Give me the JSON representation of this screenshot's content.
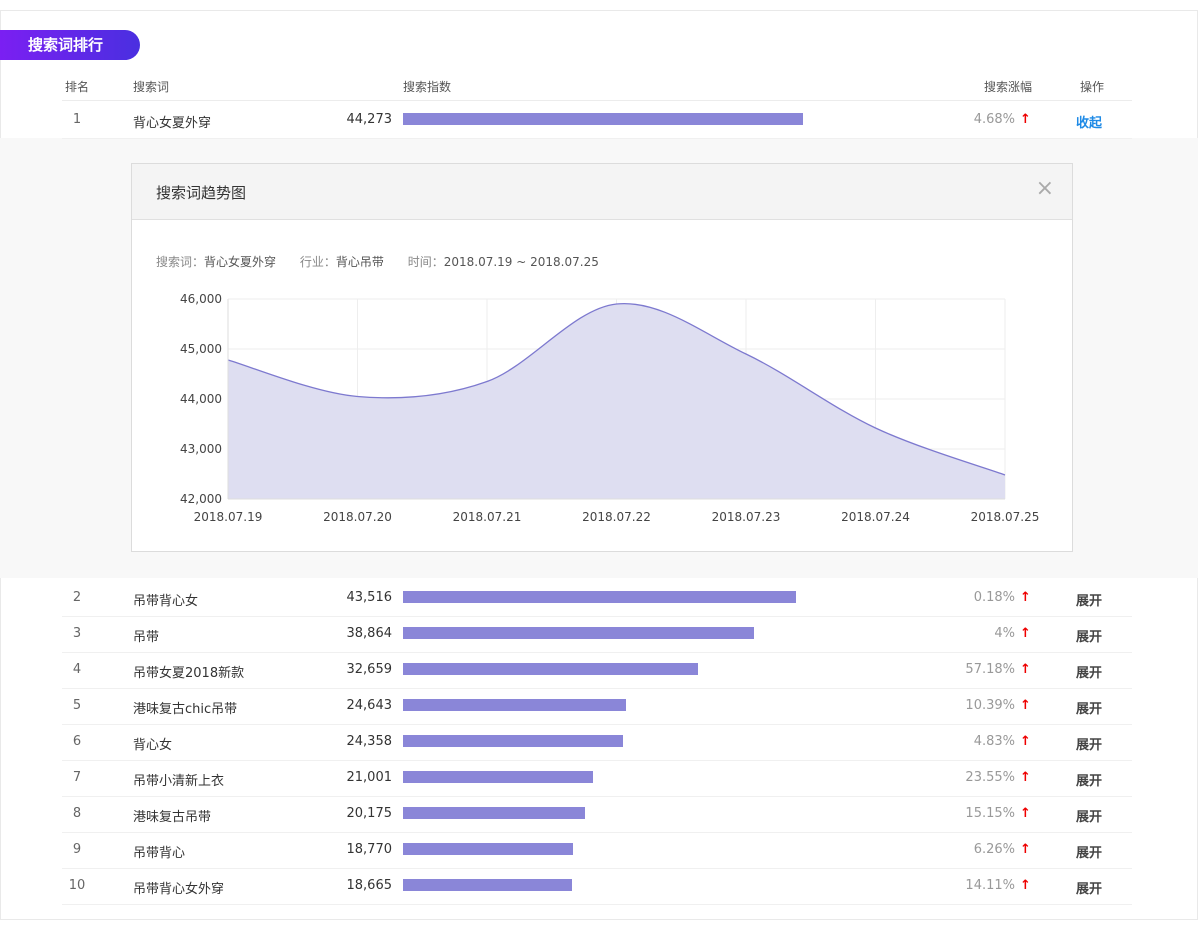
{
  "section_title": "搜索词排行",
  "headers": {
    "rank": "排名",
    "keyword": "搜索词",
    "index": "搜索指数",
    "growth": "搜索涨幅",
    "action": "操作"
  },
  "max_index": 44273,
  "rows": [
    {
      "rank": "1",
      "keyword": "背心女夏外穿",
      "index": 44273,
      "index_text": "44,273",
      "growth": "4.68%",
      "arrow": "↑",
      "action": "收起"
    },
    {
      "rank": "2",
      "keyword": "吊带背心女",
      "index": 43516,
      "index_text": "43,516",
      "growth": "0.18%",
      "arrow": "↑",
      "action": "展开"
    },
    {
      "rank": "3",
      "keyword": "吊带",
      "index": 38864,
      "index_text": "38,864",
      "growth": "4%",
      "arrow": "↑",
      "action": "展开"
    },
    {
      "rank": "4",
      "keyword": "吊带女夏2018新款",
      "index": 32659,
      "index_text": "32,659",
      "growth": "57.18%",
      "arrow": "↑",
      "action": "展开"
    },
    {
      "rank": "5",
      "keyword": "港味复古chic吊带",
      "index": 24643,
      "index_text": "24,643",
      "growth": "10.39%",
      "arrow": "↑",
      "action": "展开"
    },
    {
      "rank": "6",
      "keyword": "背心女",
      "index": 24358,
      "index_text": "24,358",
      "growth": "4.83%",
      "arrow": "↑",
      "action": "展开"
    },
    {
      "rank": "7",
      "keyword": "吊带小清新上衣",
      "index": 21001,
      "index_text": "21,001",
      "growth": "23.55%",
      "arrow": "↑",
      "action": "展开"
    },
    {
      "rank": "8",
      "keyword": "港味复古吊带",
      "index": 20175,
      "index_text": "20,175",
      "growth": "15.15%",
      "arrow": "↑",
      "action": "展开"
    },
    {
      "rank": "9",
      "keyword": "吊带背心",
      "index": 18770,
      "index_text": "18,770",
      "growth": "6.26%",
      "arrow": "↑",
      "action": "展开"
    },
    {
      "rank": "10",
      "keyword": "吊带背心女外穿",
      "index": 18665,
      "index_text": "18,665",
      "growth": "14.11%",
      "arrow": "↑",
      "action": "展开"
    }
  ],
  "trend": {
    "title": "搜索词趋势图",
    "close": "×",
    "keyword_label": "搜索词：",
    "keyword": "背心女夏外穿",
    "industry_label": "行业：",
    "industry": "背心吊带",
    "time_label": "时间：",
    "time": "2018.07.19 ~ 2018.07.25"
  },
  "colors": {
    "accent": "#7b1ff2",
    "bar": "#8a86d8",
    "area_fill": "#dcdcf0",
    "line": "#7d79cf",
    "up": "#e00000",
    "link": "#1e8ae6"
  },
  "chart_data": {
    "type": "area",
    "x": [
      "2018.07.19",
      "2018.07.20",
      "2018.07.21",
      "2018.07.22",
      "2018.07.23",
      "2018.07.24",
      "2018.07.25"
    ],
    "series": [
      {
        "values": [
          44780,
          44050,
          44350,
          45900,
          44900,
          43420,
          42480
        ]
      }
    ],
    "yticks": [
      "42,000",
      "43,000",
      "44,000",
      "45,000",
      "46,000"
    ],
    "ylim": [
      42000,
      46000
    ],
    "grid": true,
    "title": "",
    "xlabel": "",
    "ylabel": ""
  }
}
